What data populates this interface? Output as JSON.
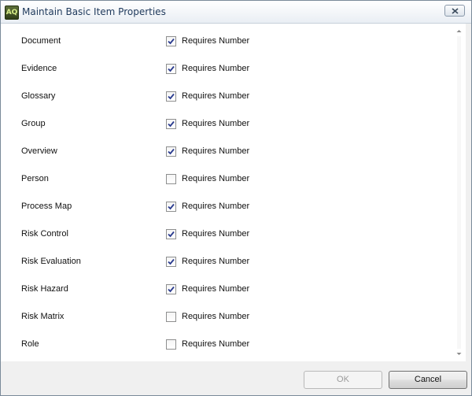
{
  "window": {
    "title": "Maintain Basic Item Properties",
    "icon": "app-logo-icon",
    "icon_text": "AQ"
  },
  "items": [
    {
      "label": "Document",
      "checkbox_label": "Requires Number",
      "checked": true
    },
    {
      "label": "Evidence",
      "checkbox_label": "Requires Number",
      "checked": true
    },
    {
      "label": "Glossary",
      "checkbox_label": "Requires Number",
      "checked": true
    },
    {
      "label": "Group",
      "checkbox_label": "Requires Number",
      "checked": true
    },
    {
      "label": "Overview",
      "checkbox_label": "Requires Number",
      "checked": true
    },
    {
      "label": "Person",
      "checkbox_label": "Requires Number",
      "checked": false
    },
    {
      "label": "Process Map",
      "checkbox_label": "Requires Number",
      "checked": true
    },
    {
      "label": "Risk Control",
      "checkbox_label": "Requires Number",
      "checked": true
    },
    {
      "label": "Risk Evaluation",
      "checkbox_label": "Requires Number",
      "checked": true
    },
    {
      "label": "Risk Hazard",
      "checkbox_label": "Requires Number",
      "checked": true
    },
    {
      "label": "Risk Matrix",
      "checkbox_label": "Requires Number",
      "checked": false
    },
    {
      "label": "Role",
      "checkbox_label": "Requires Number",
      "checked": false
    }
  ],
  "buttons": {
    "ok_label": "OK",
    "ok_enabled": false,
    "cancel_label": "Cancel"
  },
  "colors": {
    "checkmark": "#2a3b8f",
    "title_text": "#1e395b"
  }
}
